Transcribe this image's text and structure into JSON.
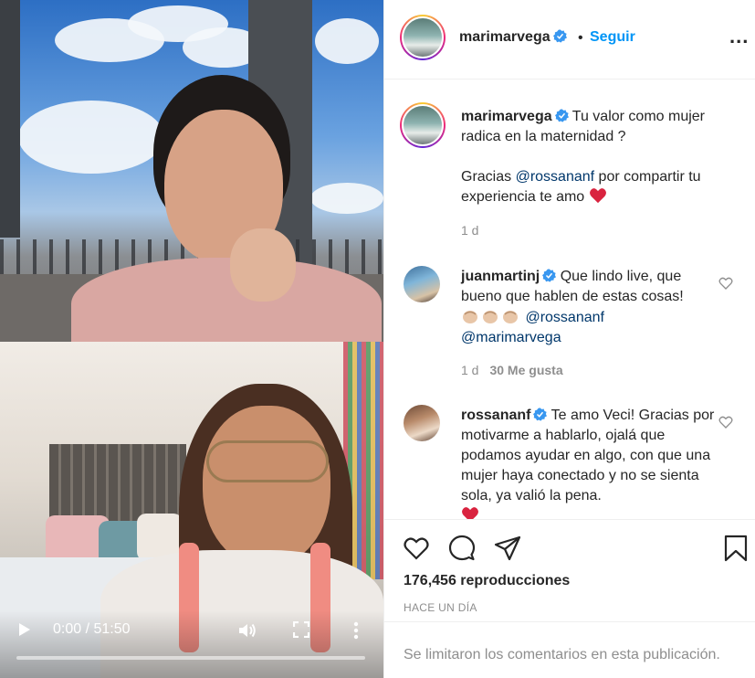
{
  "video": {
    "time_display": "0:00 / 51:50",
    "progress_fraction": 0,
    "play_icon": "play-icon",
    "volume_icon": "volume-icon",
    "fullscreen_icon": "fullscreen-icon",
    "more_icon": "more-vertical-icon"
  },
  "header": {
    "username": "marimarvega",
    "separator": "•",
    "follow_label": "Seguir",
    "more_label": "..."
  },
  "caption": {
    "username": "marimarvega",
    "line1": "Tu valor como mujer radica en la maternidad ?",
    "line2_prefix": "Gracias ",
    "line2_mention": "@rossananf",
    "line2_suffix": " por compartir tu experiencia te amo ",
    "time": "1 d"
  },
  "comments": [
    {
      "username": "juanmartinj",
      "text": "Que lindo live, que bueno que hablen de estas cosas!",
      "mention1": "@rossananf",
      "mention2": "@marimarvega",
      "time": "1 d",
      "likes": "30 Me gusta"
    },
    {
      "username": "rossananf",
      "text": "Te amo Veci! Gracias por motivarme a hablarlo, ojalá que podamos ayudar en algo, con que una mujer haya conectado y no se sienta sola, ya valió la pena."
    }
  ],
  "stats": {
    "views": "176,456 reproducciones",
    "posted": "HACE UN DÍA"
  },
  "footer": {
    "comments_limited": "Se limitaron los comentarios en esta publicación."
  },
  "colors": {
    "link_blue": "#0095f6",
    "mention_blue": "#00376b",
    "muted": "#8e8e8e",
    "verified_blue": "#3897f0",
    "heart_red": "#e0245e"
  }
}
